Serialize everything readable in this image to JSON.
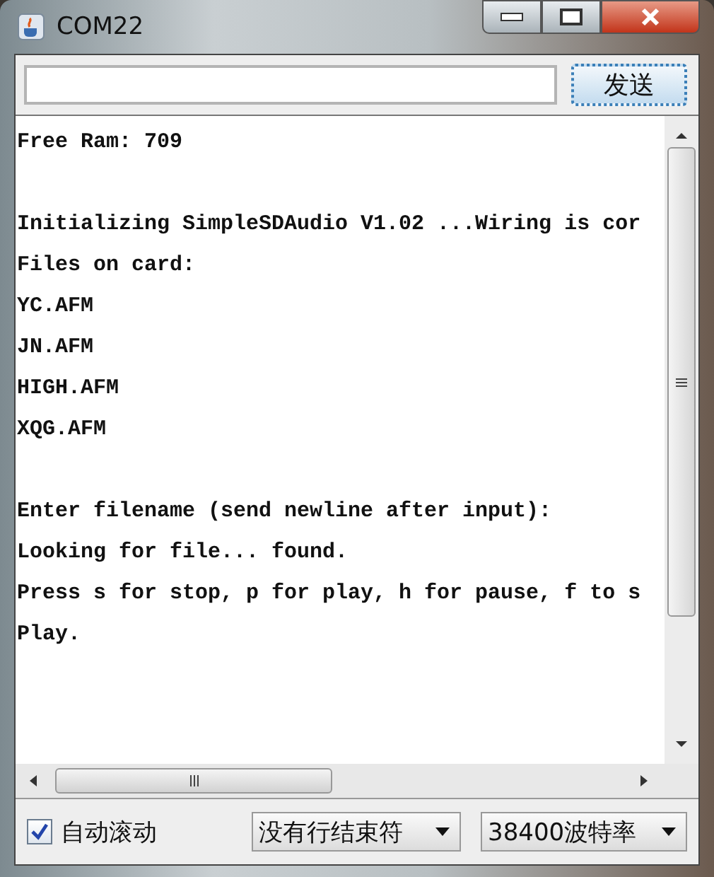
{
  "window": {
    "title": "COM22"
  },
  "send": {
    "button": "发送"
  },
  "output": {
    "lines": [
      {
        "kind": "text",
        "text": "Free Ram: 709"
      },
      {
        "kind": "blank"
      },
      {
        "kind": "text",
        "text": "Initializing SimpleSDAudio V1.02 ...Wiring is cor"
      },
      {
        "kind": "text",
        "text": "Files on card:"
      },
      {
        "kind": "text",
        "text": "YC.AFM"
      },
      {
        "kind": "text",
        "text": "JN.AFM"
      },
      {
        "kind": "text",
        "text": "HIGH.AFM"
      },
      {
        "kind": "text",
        "text": "XQG.AFM"
      },
      {
        "kind": "blank"
      },
      {
        "kind": "text",
        "text": "Enter filename (send newline after input):"
      },
      {
        "kind": "text",
        "text": "Looking for file... found."
      },
      {
        "kind": "text",
        "text": "Press s for stop, p for play, h for pause, f to s"
      },
      {
        "kind": "text",
        "text": "Play."
      }
    ]
  },
  "footer": {
    "autoscroll": {
      "label": "自动滚动",
      "checked": true
    },
    "line_ending": "没有行结束符",
    "baud_rate": "38400波特率"
  }
}
